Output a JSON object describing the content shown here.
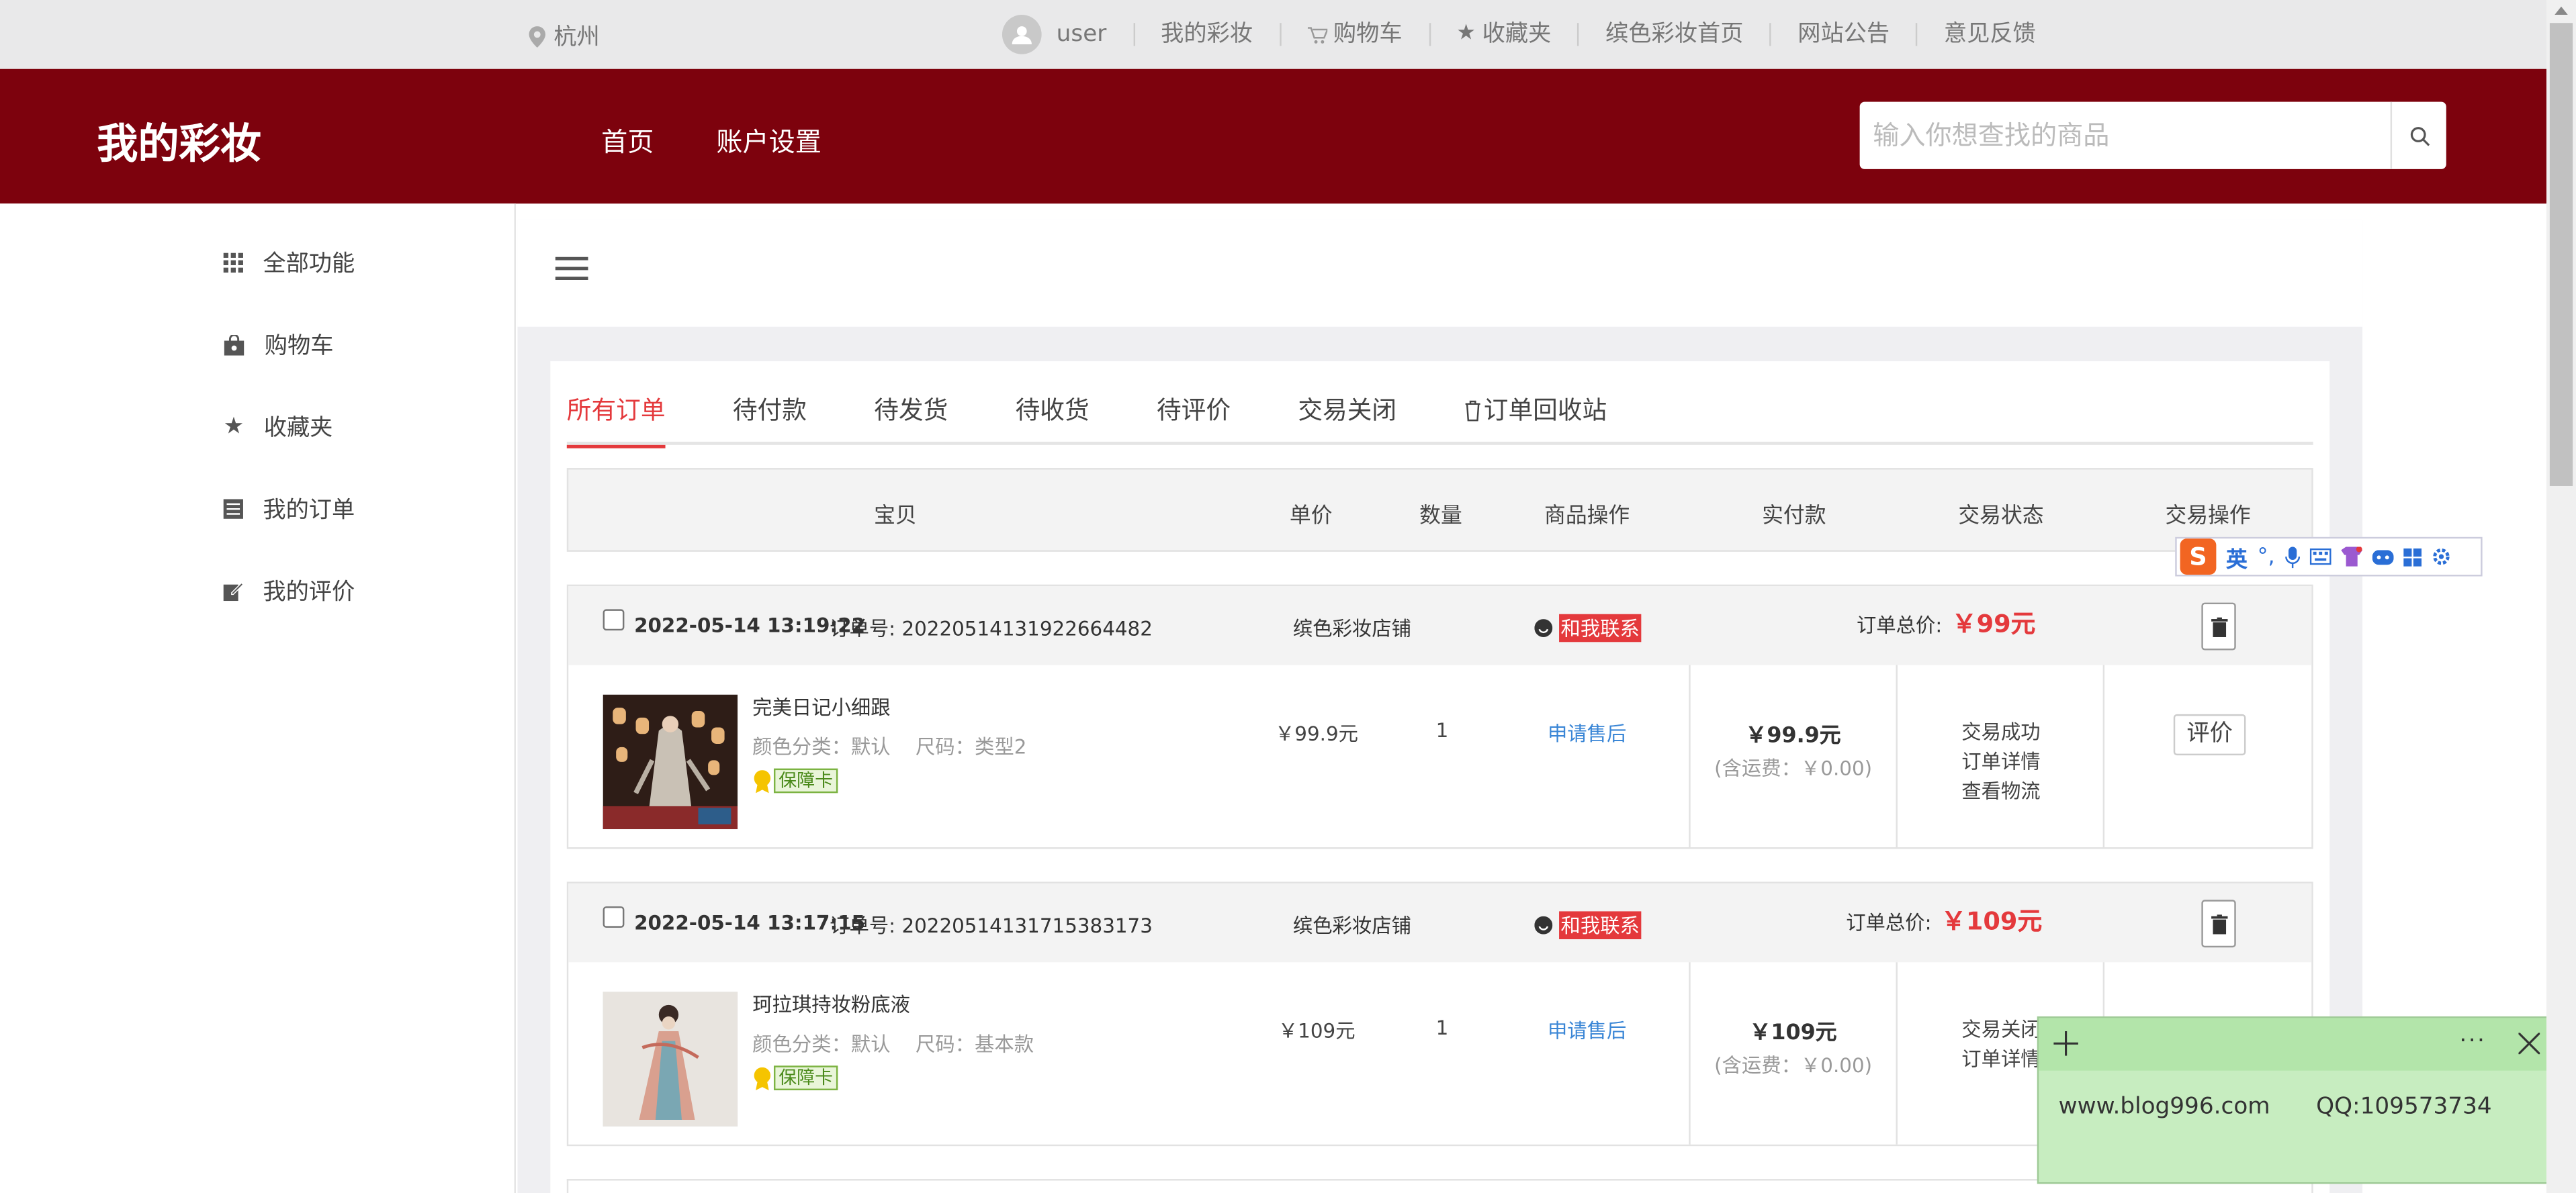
{
  "topbar": {
    "location": "杭州",
    "user": "user",
    "links": [
      "我的彩妆",
      "购物车",
      "收藏夹",
      "缤色彩妆首页",
      "网站公告",
      "意见反馈"
    ]
  },
  "header": {
    "logo": "我的彩妆",
    "nav": [
      "首页",
      "账户设置"
    ],
    "search_placeholder": "输入你想查找的商品"
  },
  "sidebar": {
    "items": [
      "全部功能",
      "购物车",
      "收藏夹",
      "我的订单",
      "我的评价"
    ]
  },
  "tabs": [
    "所有订单",
    "待付款",
    "待发货",
    "待收货",
    "待评价",
    "交易关闭",
    "订单回收站"
  ],
  "table_headers": [
    "宝贝",
    "单价",
    "数量",
    "商品操作",
    "实付款",
    "交易状态",
    "交易操作"
  ],
  "orders": [
    {
      "datetime": "2022-05-14 13:19:22",
      "order_no_label": "订单号:",
      "order_no": "20220514131922664482",
      "shop": "缤色彩妆店铺",
      "contact": "和我联系",
      "total_label": "订单总价:",
      "total": "￥99元",
      "product_name": "完美日记小细跟",
      "attrs": "颜色分类：默认    尺码：类型2",
      "guarantee": "保障卡",
      "unit_price": "￥99.9元",
      "quantity": "1",
      "after_sale": "申请售后",
      "paid": "￥99.9元",
      "shipping": "(含运费：￥0.00)",
      "status": [
        "交易成功",
        "订单详情",
        "查看物流"
      ],
      "action": "评价"
    },
    {
      "datetime": "2022-05-14 13:17:15",
      "order_no_label": "订单号:",
      "order_no": "20220514131715383173",
      "shop": "缤色彩妆店铺",
      "contact": "和我联系",
      "total_label": "订单总价:",
      "total": "￥109元",
      "product_name": "珂拉琪持妆粉底液",
      "attrs": "颜色分类：默认    尺码：基本款",
      "guarantee": "保障卡",
      "unit_price": "￥109元",
      "quantity": "1",
      "after_sale": "申请售后",
      "paid": "￥109元",
      "shipping": "(含运费：￥0.00)",
      "status": [
        "交易关闭",
        "订单详情"
      ]
    }
  ],
  "ime": {
    "logo": "S",
    "lang": "英"
  },
  "sticky_note": {
    "site": "www.blog996.com",
    "qq": "QQ:109573734"
  },
  "colors": {
    "brand": "#7d020d",
    "accent": "#e4393c",
    "link": "#3a86d6"
  }
}
